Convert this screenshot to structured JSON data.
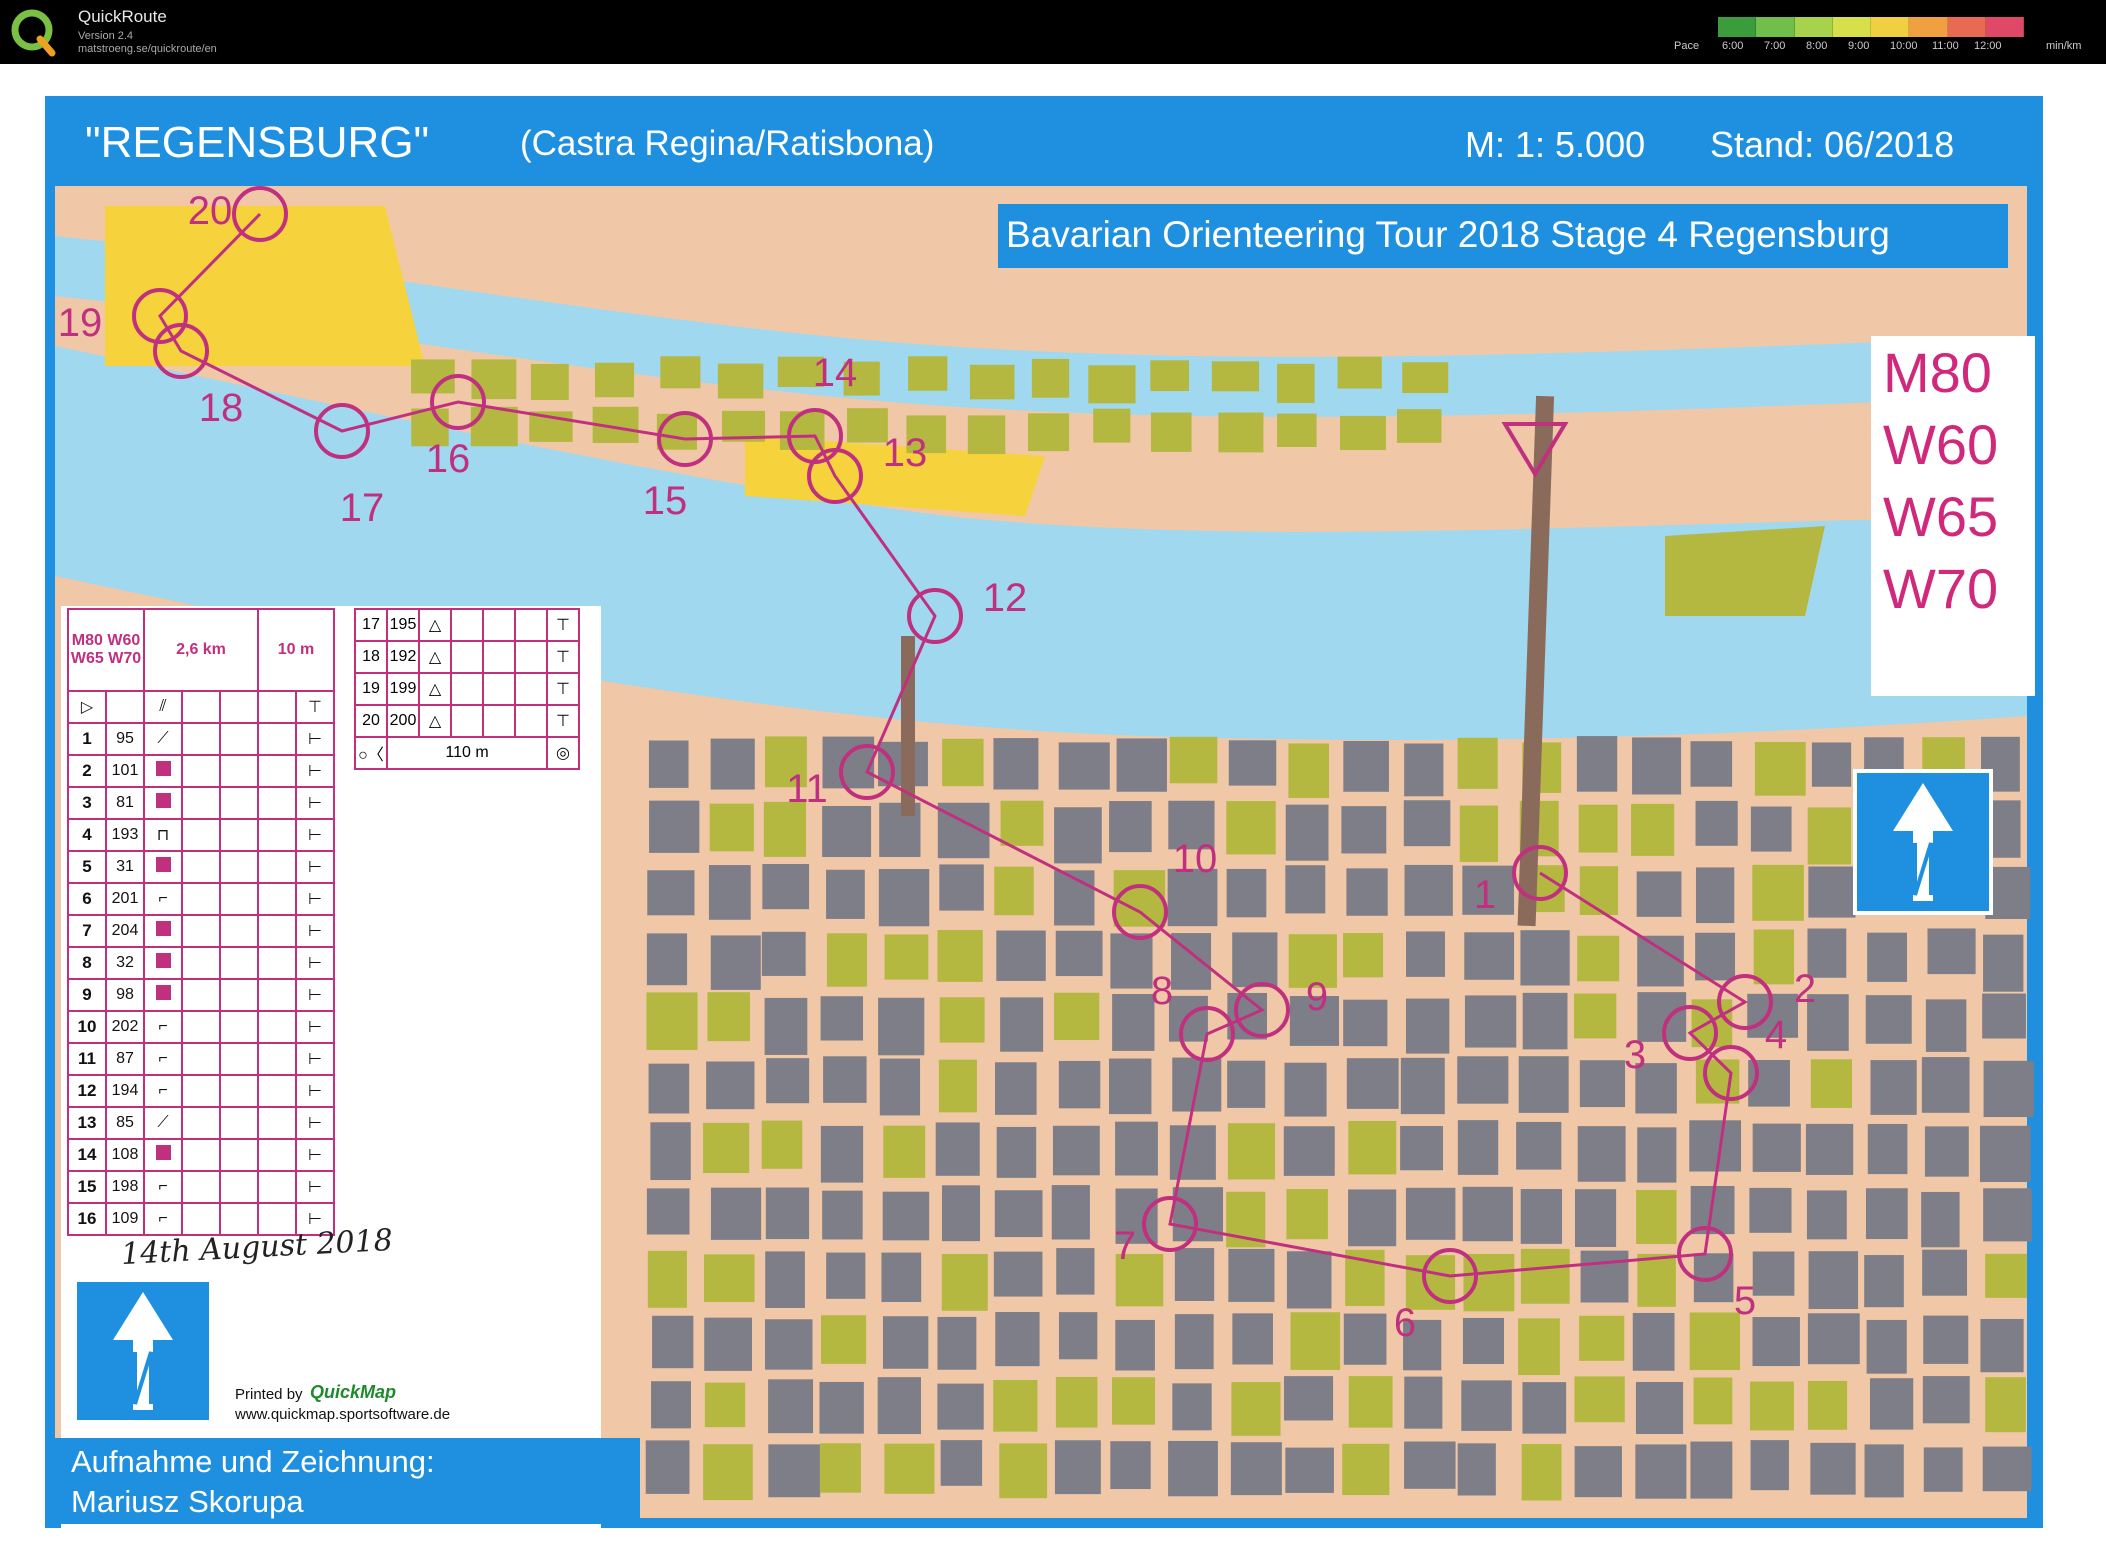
{
  "app": {
    "name": "QuickRoute",
    "version": "Version 2.4",
    "url": "matstroeng.se/quickroute/en",
    "pace_label": "Pace",
    "pace_ticks": [
      "6:00",
      "7:00",
      "8:00",
      "9:00",
      "10:00",
      "11:00",
      "12:00"
    ],
    "pace_unit": "min/km",
    "pace_colors": [
      "#3a9c3a",
      "#6fbf4a",
      "#a6d24c",
      "#d6e04a",
      "#f0d040",
      "#f0a040",
      "#e86a50",
      "#e04868"
    ]
  },
  "map": {
    "title": "\"REGENSBURG\"",
    "subtitle": "(Castra Regina/Ratisbona)",
    "scale": "M: 1: 5.000",
    "stand": "Stand: 06/2018",
    "event": "Bavarian Orienteering Tour 2018 Stage 4 Regensburg",
    "classes": [
      "M80",
      "W60",
      "W65",
      "W70"
    ],
    "printed_by": "Printed by",
    "quickmap": "QuickMap",
    "quickmap_url": "www.quickmap.sportsoftware.de",
    "date_note": "14th August 2018",
    "credits_line1": "Aufnahme und Zeichnung:",
    "credits_line2": "Mariusz Skorupa",
    "colors": {
      "sheet_blue": "#1f90e0",
      "river": "#9fd8ef",
      "street": "#f0c8a8",
      "building": "#7e7e88",
      "vegetation": "#b5b840",
      "open_land": "#f6d33c",
      "course": "#c0307f"
    },
    "controls": [
      {
        "label": "1"
      },
      {
        "label": "2"
      },
      {
        "label": "3"
      },
      {
        "label": "4"
      },
      {
        "label": "5"
      },
      {
        "label": "6"
      },
      {
        "label": "7"
      },
      {
        "label": "8"
      },
      {
        "label": "9"
      },
      {
        "label": "10"
      },
      {
        "label": "11"
      },
      {
        "label": "12"
      },
      {
        "label": "13"
      },
      {
        "label": "14"
      },
      {
        "label": "15"
      },
      {
        "label": "16"
      },
      {
        "label": "17"
      },
      {
        "label": "18"
      },
      {
        "label": "19"
      },
      {
        "label": "20"
      }
    ]
  },
  "description": {
    "classes": "M80 W60 W65 W70",
    "length": "2,6 km",
    "climb": "10 m",
    "rows": [
      {
        "num": "1",
        "code": "95"
      },
      {
        "num": "2",
        "code": "101"
      },
      {
        "num": "3",
        "code": "81"
      },
      {
        "num": "4",
        "code": "193"
      },
      {
        "num": "5",
        "code": "31"
      },
      {
        "num": "6",
        "code": "201"
      },
      {
        "num": "7",
        "code": "204"
      },
      {
        "num": "8",
        "code": "32"
      },
      {
        "num": "9",
        "code": "98"
      },
      {
        "num": "10",
        "code": "202"
      },
      {
        "num": "11",
        "code": "87"
      },
      {
        "num": "12",
        "code": "194"
      },
      {
        "num": "13",
        "code": "85"
      },
      {
        "num": "14",
        "code": "108"
      },
      {
        "num": "15",
        "code": "198"
      },
      {
        "num": "16",
        "code": "109"
      }
    ],
    "rows2": [
      {
        "num": "17",
        "code": "195"
      },
      {
        "num": "18",
        "code": "192"
      },
      {
        "num": "19",
        "code": "199"
      },
      {
        "num": "20",
        "code": "200"
      }
    ],
    "finish": "110 m"
  }
}
